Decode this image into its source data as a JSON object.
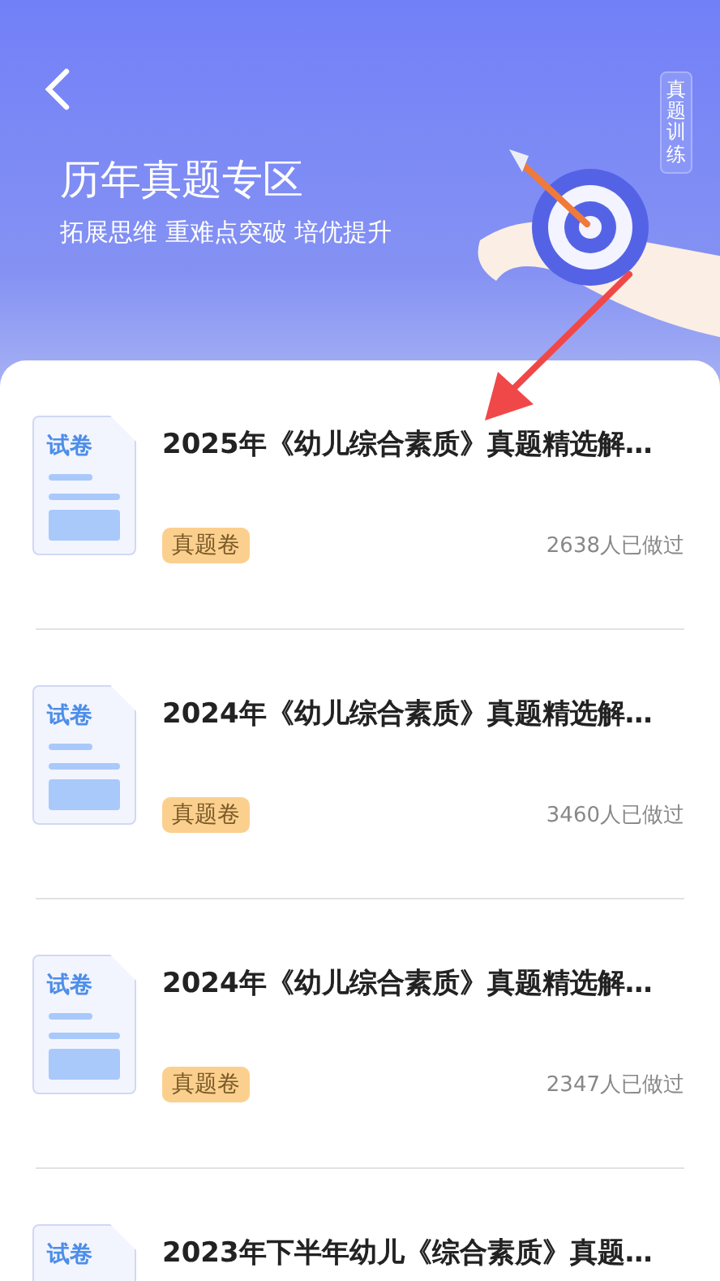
{
  "header": {
    "title": "历年真题专区",
    "subtitle": "拓展思维 重难点突破 培优提升",
    "side_badge": "真题训练"
  },
  "papers": [
    {
      "icon_label": "试卷",
      "title": "2025年《幼儿综合素质》真题精选解…",
      "tag": "真题卷",
      "done_count": "2638人已做过"
    },
    {
      "icon_label": "试卷",
      "title": "2024年《幼儿综合素质》真题精选解…",
      "tag": "真题卷",
      "done_count": "3460人已做过"
    },
    {
      "icon_label": "试卷",
      "title": "2024年《幼儿综合素质》真题精选解…",
      "tag": "真题卷",
      "done_count": "2347人已做过"
    },
    {
      "icon_label": "试卷",
      "title": "2023年下半年幼儿《综合素质》真题…"
    }
  ]
}
